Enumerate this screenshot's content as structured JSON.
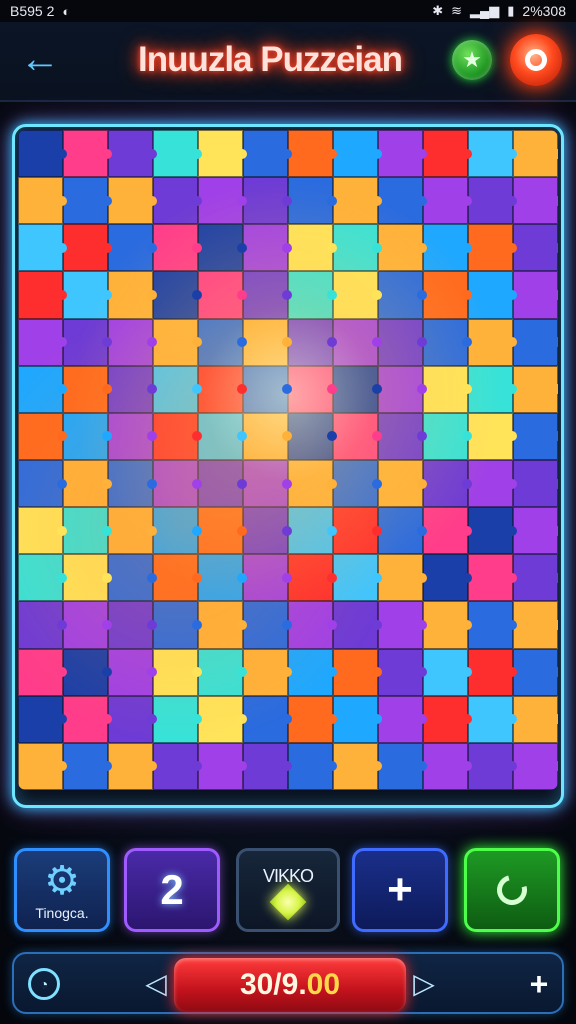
{
  "status_bar": {
    "left_text": "B595 2",
    "left_icon": "headset-icon",
    "right_text": "2%308",
    "right_icons": [
      "bluetooth-icon",
      "wifi-icon",
      "signal-icon",
      "battery-icon"
    ]
  },
  "header": {
    "title": "Inuuzla Puzzeian",
    "back_icon": "arrow-left-icon",
    "star_icon": "star-icon",
    "power_icon": "power-icon"
  },
  "board": {
    "rows": 14,
    "cols": 12,
    "palette": [
      "#1b3fa8",
      "#2a6be0",
      "#3fc6ff",
      "#37e3d9",
      "#a040e8",
      "#ff3d8b",
      "#ff6a1f",
      "#ffb23a",
      "#ffe45a",
      "#ff2e2e",
      "#6e3bd6",
      "#1fa8ff"
    ]
  },
  "controls": {
    "settings_label": "Tinogca.",
    "count_value": "2",
    "hint_label": "VIKKO",
    "add_symbol": "+"
  },
  "bottom_bar": {
    "prev_symbol": "◁",
    "next_symbol": "▷",
    "score_main": "30/9.",
    "score_tail": "00",
    "plus_symbol": "+"
  }
}
